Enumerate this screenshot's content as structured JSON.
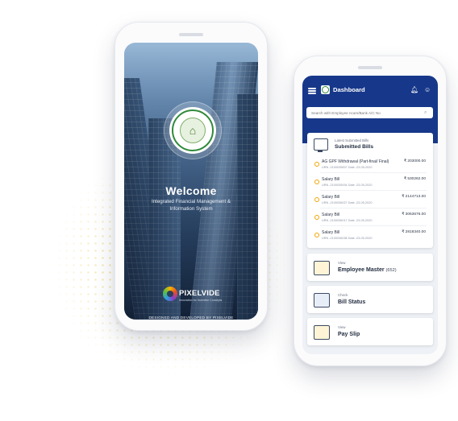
{
  "splash": {
    "welcome": "Welcome",
    "subtitle": "Integrated Financial Management & Information System",
    "brand": "PIXELVIDE",
    "brand_tagline": "Innovation for Inventive Concepts",
    "credits": "DESIGNED AND DEVELOPED BY PIXELVIDE",
    "emblem_icon": "state-emblem-icon"
  },
  "dashboard": {
    "title": "Dashboard",
    "icons": {
      "menu": "hamburger-icon",
      "notifications": "bell-icon",
      "profile": "user-icon",
      "search": "search-icon"
    },
    "search_placeholder": "Search with Employee ncam/Bank A/C No",
    "bills": {
      "small_label": "Latest Submitted Bills",
      "title": "Submitted Bills",
      "items": [
        {
          "name": "AG GPF Withdrawal (Part-final/ Final)",
          "meta": "URN -2100035837 Date -23-05-2020",
          "amount": "₹ 203000.00"
        },
        {
          "name": "Salary Bill",
          "meta": "URN -2100035934 Date -23-05-2020",
          "amount": "₹ 530262.00"
        },
        {
          "name": "Salary Bill",
          "meta": "URN -2100036027 Date -23-05-2020",
          "amount": "₹ 2144713.00"
        },
        {
          "name": "Salary Bill",
          "meta": "URN -2100036017 Date -23-05-2020",
          "amount": "₹ 3063676.00"
        },
        {
          "name": "Salary Bill",
          "meta": "URN -2100036038 Date -23-05-2020",
          "amount": "₹ 2818340.00"
        }
      ]
    },
    "menu": [
      {
        "small": "View",
        "title": "Employee Master",
        "count": "(652)"
      },
      {
        "small": "Check",
        "title": "Bill Status",
        "count": ""
      },
      {
        "small": "View",
        "title": "Pay Slip",
        "count": ""
      }
    ]
  },
  "colors": {
    "primary": "#17388a",
    "accent": "#f0a500",
    "emblem_green": "#2f8a3a"
  }
}
